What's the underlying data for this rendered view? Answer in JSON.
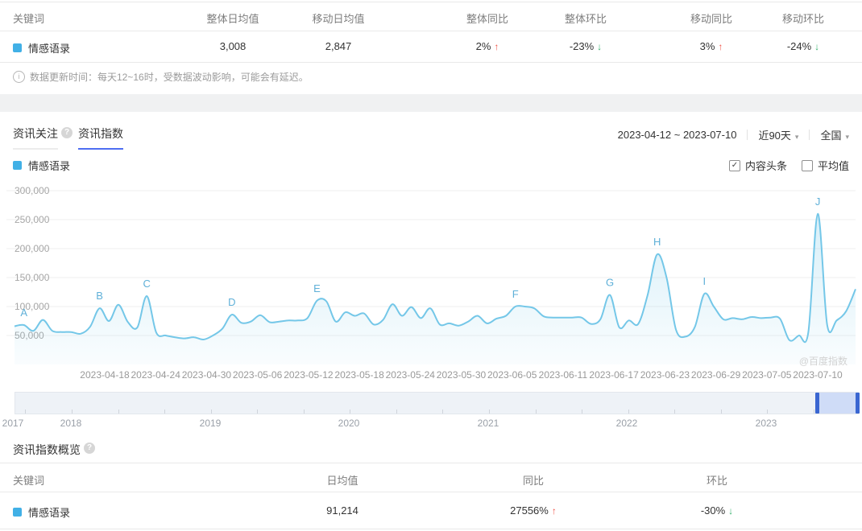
{
  "top_table": {
    "headers": [
      "关键词",
      "整体日均值",
      "移动日均值",
      "整体同比",
      "整体环比",
      "移动同比",
      "移动环比"
    ],
    "row": {
      "keyword": "情感语录",
      "overall_daily_avg": "3,008",
      "mobile_daily_avg": "2,847",
      "overall_yoy": {
        "value": "2%",
        "dir": "up"
      },
      "overall_mom": {
        "value": "-23%",
        "dir": "down"
      },
      "mobile_yoy": {
        "value": "3%",
        "dir": "up"
      },
      "mobile_mom": {
        "value": "-24%",
        "dir": "down"
      }
    },
    "note": "数据更新时间：每天12~16时，受数据波动影响，可能会有延迟。"
  },
  "tabs": [
    {
      "label": "资讯关注",
      "active": false
    },
    {
      "label": "资讯指数",
      "active": true
    }
  ],
  "controls": {
    "date_range": "2023-04-12 ~ 2023-07-10",
    "period": "近90天",
    "region": "全国"
  },
  "legend": {
    "keyword": "情感语录"
  },
  "checkboxes": [
    {
      "label": "内容头条",
      "checked": true
    },
    {
      "label": "平均值",
      "checked": false
    }
  ],
  "chart_data": {
    "type": "area",
    "title": "资讯指数趋势",
    "x_range": [
      "2023-04-12",
      "2023-07-10"
    ],
    "x_tick_labels": [
      "2023-04-18",
      "2023-04-24",
      "2023-04-30",
      "2023-05-06",
      "2023-05-12",
      "2023-05-18",
      "2023-05-24",
      "2023-05-30",
      "2023-06-05",
      "2023-06-11",
      "2023-06-17",
      "2023-06-23",
      "2023-06-29",
      "2023-07-05",
      "2023-07-10"
    ],
    "y_ticks": [
      "300,000",
      "250,000",
      "200,000",
      "150,000",
      "100,000",
      "50,000"
    ],
    "ylim": [
      0,
      300000
    ],
    "grid": true,
    "series": [
      {
        "name": "情感语录",
        "color": "#74c7e8",
        "values": [
          66000,
          68000,
          58000,
          77000,
          58000,
          56000,
          56000,
          53000,
          65000,
          97000,
          75000,
          103000,
          73000,
          64000,
          118000,
          55000,
          50000,
          47000,
          45000,
          47000,
          43000,
          50000,
          62000,
          86000,
          72000,
          74000,
          85000,
          73000,
          74000,
          76000,
          76000,
          80000,
          110000,
          109000,
          74000,
          90000,
          84000,
          88000,
          69000,
          77000,
          104000,
          84000,
          99000,
          80000,
          97000,
          69000,
          71000,
          67000,
          74000,
          84000,
          71000,
          79000,
          84000,
          100000,
          100000,
          97000,
          83000,
          81000,
          81000,
          81000,
          81000,
          70000,
          78000,
          120000,
          64000,
          76000,
          70000,
          120000,
          190000,
          150000,
          60000,
          48000,
          65000,
          122000,
          100000,
          78000,
          80000,
          78000,
          82000,
          80000,
          81000,
          79000,
          42000,
          50000,
          55000,
          260000,
          68000,
          76000,
          92000,
          130000
        ]
      }
    ],
    "markers": [
      {
        "label": "A",
        "index": 1
      },
      {
        "label": "B",
        "index": 9
      },
      {
        "label": "C",
        "index": 14
      },
      {
        "label": "D",
        "index": 23
      },
      {
        "label": "E",
        "index": 32
      },
      {
        "label": "F",
        "index": 53
      },
      {
        "label": "G",
        "index": 63
      },
      {
        "label": "H",
        "index": 68
      },
      {
        "label": "I",
        "index": 73
      },
      {
        "label": "J",
        "index": 85
      }
    ],
    "marker_color": "#5fb0d8"
  },
  "watermark": "@百度指数",
  "timeline": {
    "years": [
      "2017",
      "2018",
      "2019",
      "2020",
      "2021",
      "2022",
      "2023"
    ]
  },
  "overview": {
    "title": "资讯指数概览",
    "headers": [
      "关键词",
      "日均值",
      "同比",
      "环比"
    ],
    "row": {
      "keyword": "情感语录",
      "daily_avg": "91,214",
      "yoy": {
        "value": "27556%",
        "dir": "up"
      },
      "mom": {
        "value": "-30%",
        "dir": "down"
      }
    }
  },
  "icons": {
    "caret_down": "▾",
    "check": "✓",
    "arrow_up": "↑",
    "arrow_down": "↓",
    "help": "?",
    "info": "i"
  },
  "colors": {
    "keyword": "#41b0e6",
    "up": "#ef5448",
    "down": "#36b16e",
    "accent": "#4e6ef2",
    "line": "#74c7e8",
    "slider_handle": "#3a66d1",
    "slider_selection": "#cfdcf7"
  }
}
